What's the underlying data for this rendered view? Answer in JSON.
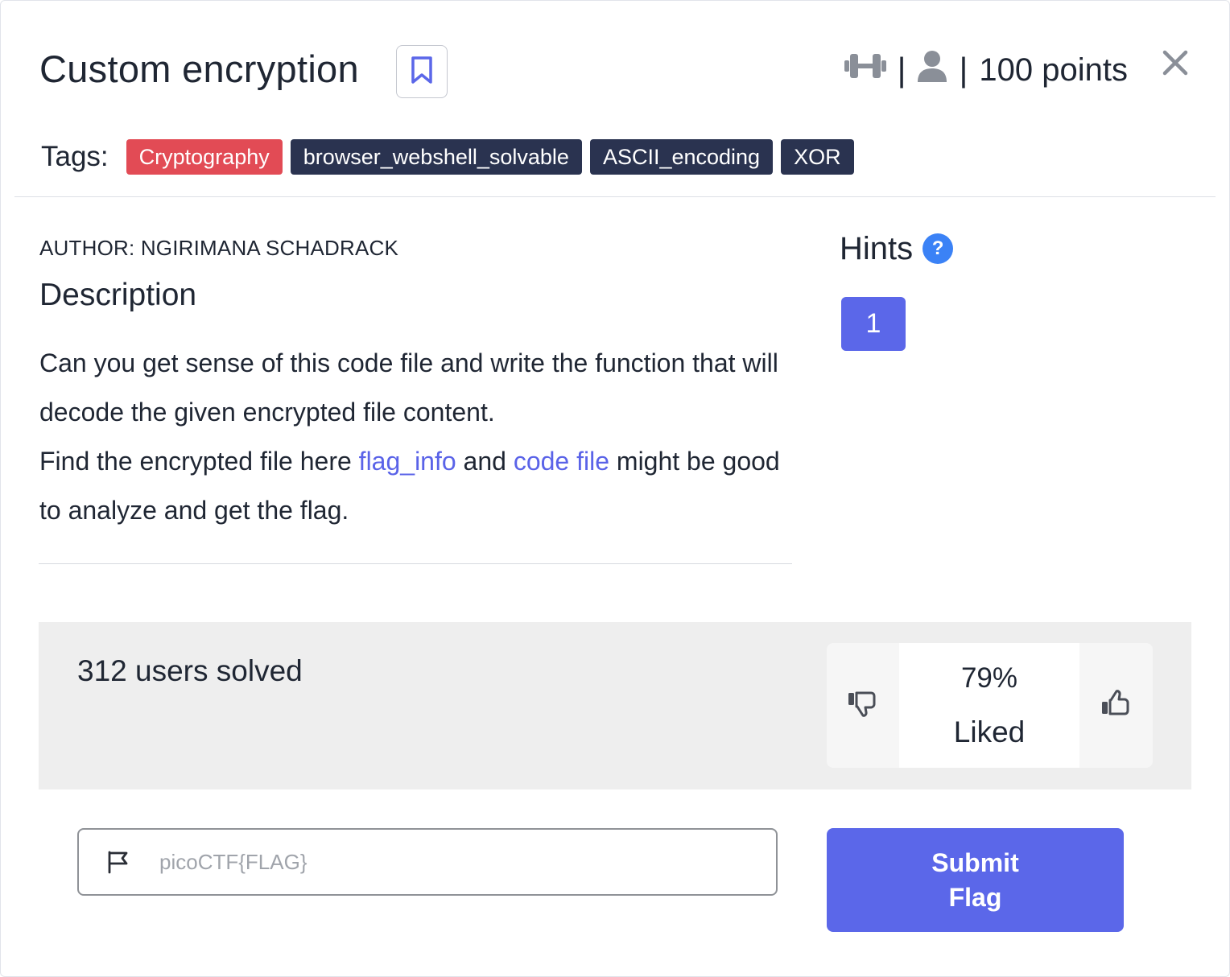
{
  "challenge": {
    "title": "Custom encryption",
    "points": "100 points",
    "separator": "|"
  },
  "tags": {
    "label": "Tags:",
    "items": [
      "Cryptography",
      "browser_webshell_solvable",
      "ASCII_encoding",
      "XOR"
    ]
  },
  "author": "AUTHOR: NGIRIMANA SCHADRACK",
  "description": {
    "heading": "Description",
    "line1": "Can you get sense of this code file and write the function that will decode the given encrypted file content.",
    "line2_prefix": "Find the encrypted file here ",
    "link1": "flag_info",
    "line2_mid": " and ",
    "link2": "code file",
    "line2_suffix": " might be good to analyze and get the flag."
  },
  "hints": {
    "heading": "Hints",
    "help_symbol": "?",
    "items": [
      "1"
    ]
  },
  "stats": {
    "solved": "312 users solved",
    "liked_percent": "79%",
    "liked_label": "Liked"
  },
  "submit": {
    "placeholder": "picoCTF{FLAG}",
    "button_label": "Submit Flag"
  },
  "icons": [
    "bookmark-icon",
    "difficulty-icon",
    "user-icon",
    "close-icon",
    "thumbs-down-icon",
    "thumbs-up-icon",
    "flag-icon"
  ],
  "colors": {
    "accent": "#5b67e9",
    "link": "#5a63e8",
    "tag_primary": "#e24b55",
    "tag_dark": "#2a3350",
    "help": "#3b82f6"
  }
}
